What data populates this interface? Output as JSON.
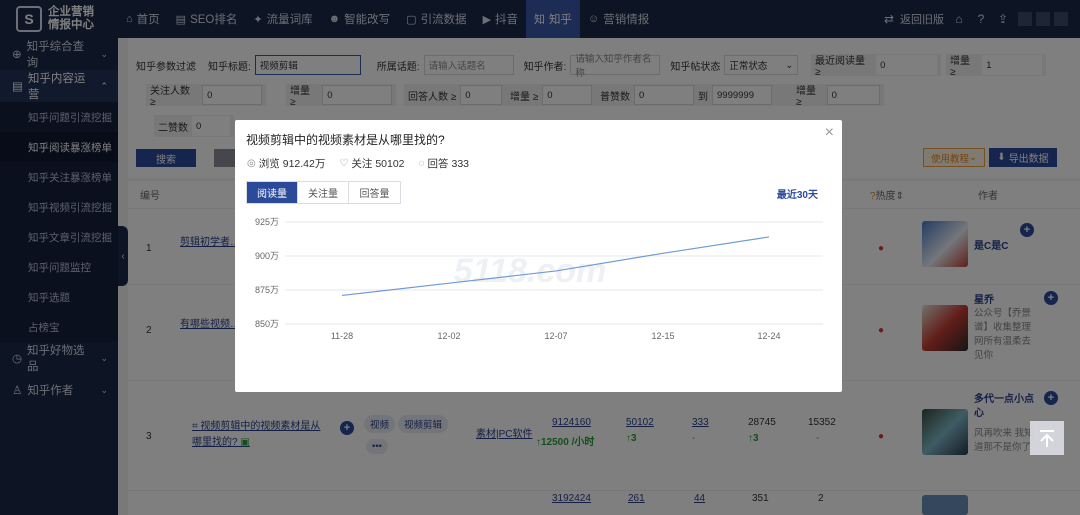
{
  "brand": {
    "line1": "企业营销",
    "line2": "情报中心"
  },
  "topnav": {
    "items": [
      {
        "icon": "home-icon",
        "glyph": "⌂",
        "label": "首页"
      },
      {
        "icon": "seo-icon",
        "glyph": "▤",
        "label": "SEO排名"
      },
      {
        "icon": "traffic-icon",
        "glyph": "✦",
        "label": "流量词库"
      },
      {
        "icon": "rewrite-icon",
        "glyph": "☻",
        "label": "智能改写"
      },
      {
        "icon": "lead-icon",
        "glyph": "▢",
        "label": "引流数据"
      },
      {
        "icon": "douyin-icon",
        "glyph": "▶",
        "label": "抖音"
      },
      {
        "icon": "zhihu-icon",
        "glyph": "知",
        "label": "知乎"
      },
      {
        "icon": "marketing-icon",
        "glyph": "☺",
        "label": "营销情报"
      }
    ],
    "active_index": 6,
    "back_old": "返回旧版"
  },
  "sidebar": {
    "groups": [
      {
        "icon": "globe-icon",
        "glyph": "⊕",
        "label": "知乎综合查询",
        "chevron": "⌄"
      },
      {
        "icon": "document-icon",
        "glyph": "▤",
        "label": "知乎内容运营",
        "chevron": "⌃"
      },
      {
        "icon": "goods-icon",
        "glyph": "◷",
        "label": "知乎好物选品",
        "chevron": "⌄"
      },
      {
        "icon": "user-icon",
        "glyph": "♙",
        "label": "知乎作者",
        "chevron": "⌄"
      }
    ],
    "subitems": [
      "知乎问题引流挖掘",
      "知乎阅读暴涨榜单",
      "知乎关注暴涨榜单",
      "知乎视频引流挖掘",
      "知乎文章引流挖掘",
      "知乎问题监控",
      "知乎选题",
      "占榜宝"
    ],
    "active_sub": 1
  },
  "filters": {
    "section_label": "知乎参数过滤",
    "title_label": "知乎标题:",
    "title_value": "视频剪辑",
    "topic_label": "所属话题:",
    "topic_placeholder": "请输入话题名",
    "author_label": "知乎作者:",
    "author_placeholder": "请输入知乎作者名称",
    "status_label": "知乎帖状态",
    "status_value": "正常状态",
    "recent_read_label": "最近阅读量 ≥",
    "recent_read_value": "0",
    "incr_label": "增量 ≥",
    "incr1_value": "1",
    "follow_label": "关注人数 ≥",
    "follow_value": "0",
    "incr2_value": "0",
    "answer_label": "回答人数 ≥",
    "answer_value": "0",
    "incr3_value": "0",
    "likes_label": "普赞数",
    "likes_from": "0",
    "likes_to_label": "到",
    "likes_to": "9999999",
    "incr4_value": "0",
    "second_likes_label": "二赞数",
    "second_likes_value": "0",
    "search_btn": "搜索",
    "usage_btn": "使用教程",
    "export_btn": "导出数据"
  },
  "table": {
    "headers": {
      "no": "编号",
      "heat": "热度",
      "author": "作者"
    },
    "rows": [
      {
        "no": "1",
        "title": "剪辑初学者…辑?",
        "author": "是C是C"
      },
      {
        "no": "2",
        "title": "有哪些视频…",
        "author": "星乔",
        "author_desc": "公众号【乔景谱】收集整理网所有温柔去见你"
      },
      {
        "no": "3",
        "title": "视频剪辑中的视频素材是从哪里找的?",
        "tags": [
          "视频",
          "视频剪辑"
        ],
        "more": "•••",
        "source": "素材|PC软件",
        "reads": "9124160",
        "read_rate": "↑12500 /小时",
        "follows": "50102",
        "follow_incr": "↑3",
        "answers": "333",
        "answer_incr": "-",
        "likes": "28745",
        "likes_incr": "↑3",
        "col7": "15352",
        "col7_incr": "-",
        "author": "多代一点小点心",
        "author_desc": "风再吹来 我知道那不是你了"
      },
      {
        "no": "4",
        "reads": "3192424",
        "follows": "261",
        "answers": "44",
        "likes": "351",
        "col7": "2"
      }
    ]
  },
  "modal": {
    "title": "视频剪辑中的视频素材是从哪里找的?",
    "views_label": "浏览",
    "views": "912.42万",
    "follows_label": "关注",
    "follows": "50102",
    "answers_label": "回答",
    "answers": "333",
    "tabs": [
      "阅读量",
      "关注量",
      "回答量"
    ],
    "active_tab": 0,
    "range": "最近30天",
    "watermark": "5118.com"
  },
  "chart_data": {
    "type": "line",
    "x": [
      "11-28",
      "12-02",
      "12-07",
      "12-15",
      "12-24"
    ],
    "y": [
      871,
      880,
      889,
      902,
      914
    ],
    "y_unit": "万",
    "yticks": [
      "925万",
      "900万",
      "875万",
      "850万"
    ],
    "ylim": [
      850,
      925
    ],
    "grid": true,
    "color": "#6f9bd6"
  }
}
